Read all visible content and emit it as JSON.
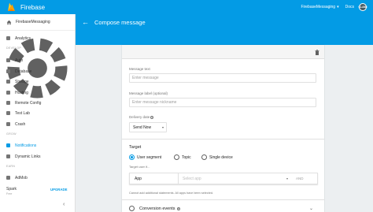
{
  "topbar": {
    "brand": "Firebase",
    "project": "FirebaseMessaging",
    "caret": "▾",
    "docs": "Docs",
    "avatar_text": "CLAMI"
  },
  "sidebar": {
    "project_name": "FirebaseMessaging",
    "sections": {
      "develop": "DEVELOP",
      "grow": "GROW",
      "earn": "EARN"
    },
    "items": [
      {
        "label": "Analytics"
      },
      {
        "label": "Auth"
      },
      {
        "label": "Database"
      },
      {
        "label": "Storage"
      },
      {
        "label": "Hosting"
      },
      {
        "label": "Remote Config"
      },
      {
        "label": "Test Lab"
      },
      {
        "label": "Crash"
      },
      {
        "label": "Notifications"
      },
      {
        "label": "Dynamic Links"
      },
      {
        "label": "AdMob"
      }
    ],
    "plan": "Spark",
    "plan_sub": "Free",
    "upgrade": "UPGRADE",
    "collapse": "‹"
  },
  "header": {
    "back": "←",
    "title": "Compose message"
  },
  "form": {
    "message_text_label": "Message text",
    "message_text_placeholder": "Enter message",
    "message_label_label": "Message label (optional)",
    "message_label_placeholder": "Enter message nickname",
    "delivery_label": "Delivery date",
    "help_glyph": "?",
    "delivery_value": "Send Now",
    "select_caret": "▾"
  },
  "target": {
    "title": "Target",
    "options": [
      "User segment",
      "Topic",
      "Single device"
    ],
    "selected": "User segment",
    "target_user_if": "Target user if...",
    "app_label": "App",
    "select_app_placeholder": "Select app",
    "and": "AND",
    "note": "Cannot add additional statements. All apps have been selected."
  },
  "conversion": {
    "label": "Conversion events",
    "caret": "⌄"
  },
  "colors": {
    "accent": "#039be5",
    "background": "#eceff1"
  }
}
